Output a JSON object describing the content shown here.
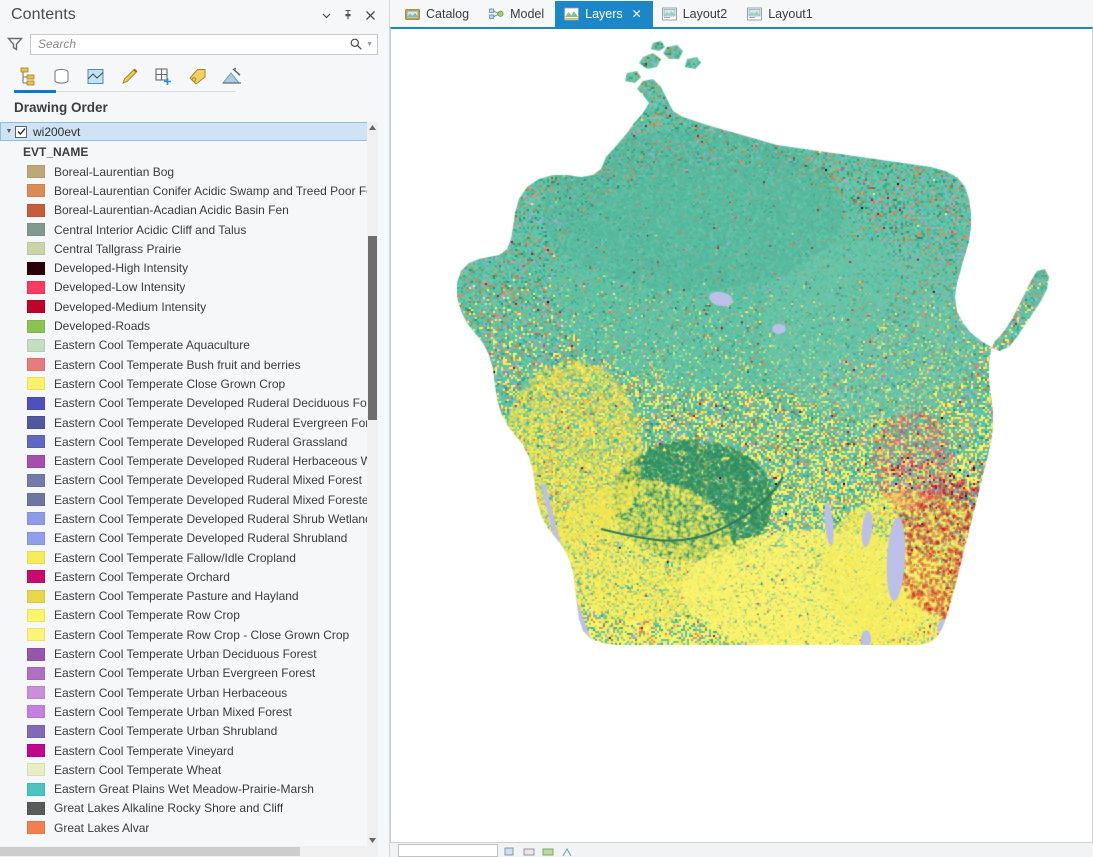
{
  "pane": {
    "title": "Contents",
    "buttons": [
      {
        "name": "menu-dropdown",
        "icon": "chevron-down-icon",
        "label": "▾"
      },
      {
        "name": "auto-hide",
        "icon": "pin-icon",
        "label": "↧"
      },
      {
        "name": "close",
        "icon": "close-icon",
        "label": "✕"
      }
    ],
    "search": {
      "placeholder": "Search",
      "value": ""
    },
    "toolbar_icons": [
      "list-by-drawing-order-icon",
      "list-by-data-source-icon",
      "list-by-selection-icon",
      "list-by-editing-icon",
      "list-by-snapping-icon",
      "list-by-labeling-icon",
      "list-by-charts-icon"
    ],
    "section_title": "Drawing Order"
  },
  "layer": {
    "name": "wi200evt",
    "checked": true,
    "expanded": true,
    "field_name": "EVT_NAME"
  },
  "legend": [
    {
      "label": "Boreal-Laurentian Bog",
      "color": "#bfa877"
    },
    {
      "label": "Boreal-Laurentian Conifer Acidic Swamp and Treed Poor Fen",
      "color": "#d98c57"
    },
    {
      "label": "Boreal-Laurentian-Acadian Acidic Basin Fen",
      "color": "#c85c38"
    },
    {
      "label": "Central Interior Acidic Cliff and Talus",
      "color": "#81998f"
    },
    {
      "label": "Central Tallgrass Prairie",
      "color": "#cdd3a8"
    },
    {
      "label": "Developed-High Intensity",
      "color": "#2a0008"
    },
    {
      "label": "Developed-Low Intensity",
      "color": "#fa3a5e"
    },
    {
      "label": "Developed-Medium Intensity",
      "color": "#c00328"
    },
    {
      "label": "Developed-Roads",
      "color": "#8cc254"
    },
    {
      "label": "Eastern Cool Temperate Aquaculture",
      "color": "#c5ddc0"
    },
    {
      "label": "Eastern Cool Temperate Bush fruit and berries",
      "color": "#e87b7b"
    },
    {
      "label": "Eastern Cool Temperate Close Grown Crop",
      "color": "#fcf267"
    },
    {
      "label": "Eastern Cool Temperate Developed Ruderal Deciduous Forest",
      "color": "#4f50bb"
    },
    {
      "label": "Eastern Cool Temperate Developed Ruderal Evergreen Forest",
      "color": "#50589f"
    },
    {
      "label": "Eastern Cool Temperate Developed Ruderal Grassland",
      "color": "#5f68bf"
    },
    {
      "label": "Eastern Cool Temperate Developed Ruderal Herbaceous Wetland",
      "color": "#a34fab"
    },
    {
      "label": "Eastern Cool Temperate Developed Ruderal Mixed Forest",
      "color": "#737ca8"
    },
    {
      "label": "Eastern Cool Temperate Developed Ruderal Mixed Forested",
      "color": "#6d769f"
    },
    {
      "label": "Eastern Cool Temperate Developed Ruderal Shrub Wetland",
      "color": "#8e9ce8"
    },
    {
      "label": "Eastern Cool Temperate Developed Ruderal Shrubland",
      "color": "#8f9fe8"
    },
    {
      "label": "Eastern Cool Temperate Fallow/Idle Cropland",
      "color": "#f4ec5a"
    },
    {
      "label": "Eastern Cool Temperate Orchard",
      "color": "#c80a6c"
    },
    {
      "label": "Eastern Cool Temperate Pasture and Hayland",
      "color": "#e6d84a"
    },
    {
      "label": "Eastern Cool Temperate Row Crop",
      "color": "#fbf46d"
    },
    {
      "label": "Eastern Cool Temperate Row Crop - Close Grown Crop",
      "color": "#fbf577"
    },
    {
      "label": "Eastern Cool Temperate Urban Deciduous Forest",
      "color": "#9556ab"
    },
    {
      "label": "Eastern Cool Temperate Urban Evergreen Forest",
      "color": "#ae6fc4"
    },
    {
      "label": "Eastern Cool Temperate Urban Herbaceous",
      "color": "#c98fd9"
    },
    {
      "label": "Eastern Cool Temperate Urban Mixed Forest",
      "color": "#c47fe0"
    },
    {
      "label": "Eastern Cool Temperate Urban Shrubland",
      "color": "#8169b8"
    },
    {
      "label": "Eastern Cool Temperate Vineyard",
      "color": "#c1078b"
    },
    {
      "label": "Eastern Cool Temperate Wheat",
      "color": "#e8eec0"
    },
    {
      "label": "Eastern Great Plains Wet Meadow-Prairie-Marsh",
      "color": "#4cc2c2"
    },
    {
      "label": "Great Lakes Alkaline Rocky Shore and Cliff",
      "color": "#5a5a5a"
    },
    {
      "label": "Great Lakes Alvar",
      "color": "#f08050"
    }
  ],
  "tabs": [
    {
      "label": "Catalog",
      "icon": "catalog-icon",
      "active": false,
      "closable": false
    },
    {
      "label": "Model",
      "icon": "model-icon",
      "active": false,
      "closable": false
    },
    {
      "label": "Layers",
      "icon": "map-icon",
      "active": true,
      "closable": true
    },
    {
      "label": "Layout2",
      "icon": "layout-icon",
      "active": false,
      "closable": false
    },
    {
      "label": "Layout1",
      "icon": "layout-icon",
      "active": false,
      "closable": false
    }
  ],
  "map": {
    "name": "wisconsin-landcover-map",
    "background": "#ffffff",
    "water_color": "#bcc0e8",
    "accent": "#1b87c9"
  },
  "statusbar": {
    "value": ""
  }
}
